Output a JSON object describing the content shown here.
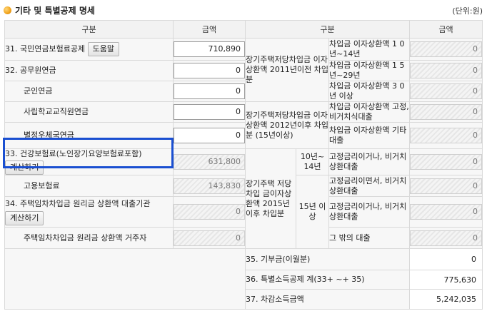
{
  "title": "기타 및 특별공제 명세",
  "unit": "(단위:원)",
  "header": {
    "col_label": "구분",
    "col_amount": "금액"
  },
  "left": {
    "r31": {
      "label": "31. 국민연금보험료공제",
      "button": "도움말",
      "value": "710,890"
    },
    "r32": {
      "label": "32. 공무원연금",
      "value": "0"
    },
    "r32a": {
      "label": "군인연금",
      "value": "0"
    },
    "r32b": {
      "label": "사립학교교직원연금",
      "value": "0"
    },
    "r32c": {
      "label": "별정우체국연금",
      "value": "0"
    },
    "r33": {
      "label": "33. 건강보험료(노인장기요양보험료포함)",
      "button": "계산하기",
      "value": "631,800"
    },
    "r33a": {
      "label": "고용보험료",
      "value": "143,830"
    },
    "r34": {
      "label": "34. 주택임차차입금 원리금 상환액 대출기관",
      "button": "계산하기",
      "value": "0"
    },
    "r34a": {
      "label": "주택임차차입금 원리금 상환액 거주자",
      "value": "0"
    }
  },
  "right": {
    "g1": {
      "label": "장기주택저당차입금 이자상환액 2011년이전 차입분",
      "rows": [
        {
          "label": "차입금 이자상환액 1 0년~14년",
          "value": "0"
        },
        {
          "label": "차입금 이자상환액 1 5년~29년",
          "value": "0"
        },
        {
          "label": "차입금 이자상환액 3 0년 이상",
          "value": "0"
        }
      ]
    },
    "g2": {
      "label": "장기주택저당차입금 이자상환액 2012년이후 차입분 (15년이상)",
      "rows": [
        {
          "label": "차입금 이자상환액 고정,비거치식대출",
          "value": "0"
        },
        {
          "label": "차입금 이자상환액 기타대출",
          "value": "0"
        }
      ]
    },
    "g3": {
      "label": "장기주택 저당차입 금이자상 환액 2015년 이후 차입분",
      "sub1": {
        "label": "10년~ 14년",
        "rows": [
          {
            "label": "고정금리이거나, 비거치상환대출",
            "value": "0"
          }
        ]
      },
      "sub2": {
        "label": "15년 이상",
        "rows": [
          {
            "label": "고정금리이면서, 비거치상환대출",
            "value": "0"
          },
          {
            "label": "고정금리이거나, 비거치상환대출",
            "value": "0"
          },
          {
            "label": "그 밖의 대출",
            "value": "0"
          }
        ]
      }
    },
    "r35": {
      "label": "35. 기부금(이월분)",
      "value": "0"
    },
    "r36": {
      "label": "36. 특별소득공제 계(33+ ~+ 35)",
      "value": "775,630"
    },
    "r37": {
      "label": "37. 차감소득금액",
      "value": "5,242,035"
    }
  }
}
